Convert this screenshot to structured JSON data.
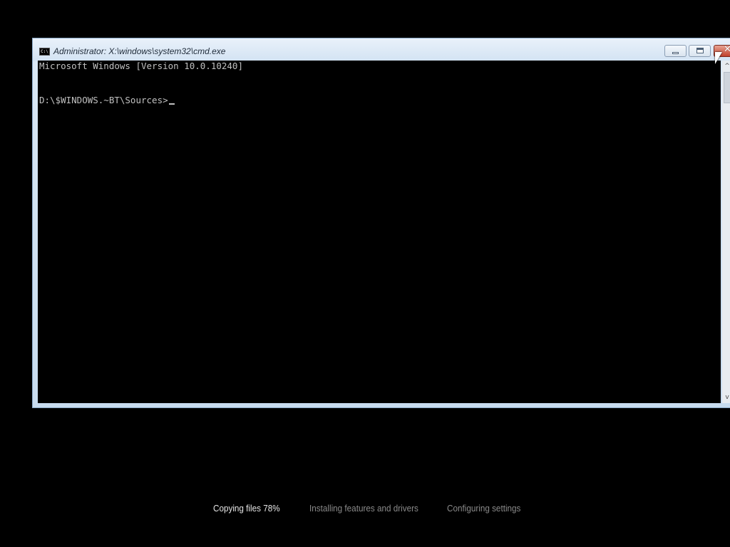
{
  "window": {
    "title": "Administrator: X:\\windows\\system32\\cmd.exe",
    "icon": "cmd-app-icon",
    "icon_text": "C:\\",
    "controls": {
      "minimize": "minimize-icon",
      "maximize": "maximize-icon",
      "close": "close-icon",
      "close_glyph": "✕"
    }
  },
  "console": {
    "lines": [
      "Microsoft Windows [Version 10.0.10240]",
      "D:\\$WINDOWS.~BT\\Sources>"
    ],
    "text_color": "#c0c0c0",
    "background": "#000000"
  },
  "scrollbar": {
    "up_arrow": "^",
    "down_arrow": "v"
  },
  "setup_progress": {
    "steps": [
      {
        "label": "Copying files 78%",
        "active": true,
        "percent": 78
      },
      {
        "label": "Installing features and drivers",
        "active": false
      },
      {
        "label": "Configuring settings",
        "active": false
      }
    ]
  }
}
